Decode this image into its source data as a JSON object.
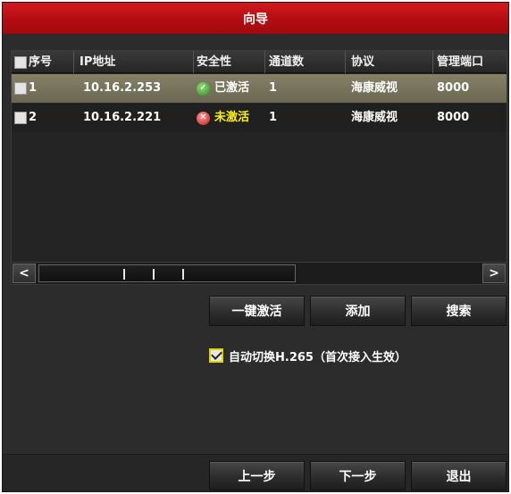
{
  "window": {
    "title": "向导"
  },
  "table": {
    "columns": [
      "序号",
      "IP地址",
      "安全性",
      "通道数",
      "协议",
      "管理端口"
    ],
    "rows": [
      {
        "index": "1",
        "ip": "10.16.2.253",
        "security": "已激活",
        "security_state": "active",
        "channels": "1",
        "protocol": "海康威视",
        "port": "8000"
      },
      {
        "index": "2",
        "ip": "10.16.2.221",
        "security": "未激活",
        "security_state": "inactive",
        "channels": "1",
        "protocol": "海康威视",
        "port": "8000"
      }
    ]
  },
  "scrollbar": {
    "left_arrow": "<",
    "right_arrow": ">"
  },
  "actions": {
    "activate": "一键激活",
    "add": "添加",
    "search": "搜索"
  },
  "options": {
    "auto_switch_label": "自动切换H.265（首次接入生效）",
    "auto_switch_checked": true
  },
  "nav": {
    "prev": "上一步",
    "next": "下一步",
    "exit": "退出"
  },
  "colors": {
    "title_bar": "#c8141a",
    "selected_row": "#7a7560",
    "inactive_text": "#fff200",
    "checkbox_border": "#e6d200"
  }
}
